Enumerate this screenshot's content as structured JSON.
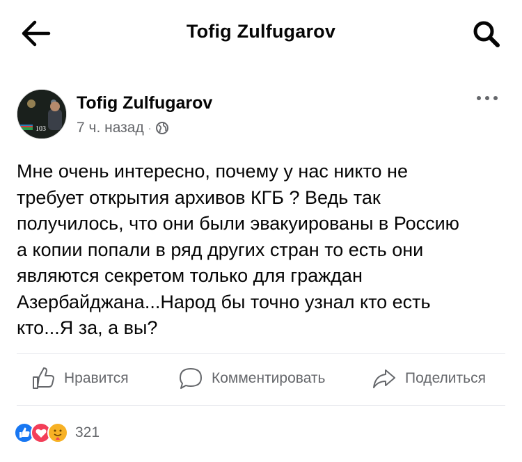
{
  "header": {
    "title": "Tofig Zulfugarov",
    "back_icon": "arrow-left-icon",
    "search_icon": "search-icon"
  },
  "post": {
    "author": "Tofig Zulfugarov",
    "time": "7 ч. назад",
    "separator": "·",
    "privacy_icon": "globe-icon",
    "avatar_badge": "103",
    "text": "Мне очень интересно, почему у нас никто не\nтребует открытия архивов КГБ ? Ведь так\nполучилось, что они были эвакуированы в Россию\nа копии попали в ряд других стран то есть они\nявляются секретом только для граждан\nАзербайджана...Народ бы точно узнал кто есть\nкто...Я за, а вы?"
  },
  "actions": {
    "like_label": "Нравится",
    "comment_label": "Комментировать",
    "share_label": "Поделиться"
  },
  "reactions": {
    "types": [
      "like",
      "love",
      "care"
    ],
    "count": "321"
  },
  "colors": {
    "text": "#050505",
    "secondary": "#65676b",
    "like_blue": "#1877f2",
    "love_red": "#f33e58",
    "care_yellow": "#f7b125"
  }
}
